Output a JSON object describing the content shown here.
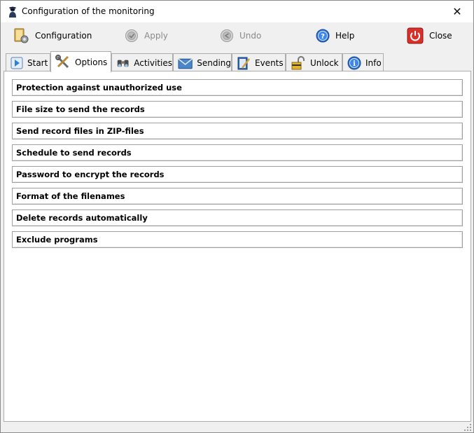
{
  "window": {
    "title": "Configuration of the monitoring",
    "close_glyph": "✕"
  },
  "toolbar": {
    "configuration": "Configuration",
    "apply": "Apply",
    "undo": "Undo",
    "help": "Help",
    "close": "Close"
  },
  "tabs": [
    {
      "label": "Start",
      "icon": "play-icon"
    },
    {
      "label": "Options",
      "icon": "tools-icon",
      "active": true
    },
    {
      "label": "Activities",
      "icon": "binoculars-icon"
    },
    {
      "label": "Sending",
      "icon": "mail-icon"
    },
    {
      "label": "Events",
      "icon": "notepad-icon"
    },
    {
      "label": "Unlock",
      "icon": "padlock-icon"
    },
    {
      "label": "Info",
      "icon": "info-icon"
    }
  ],
  "sections": [
    "Protection against unauthorized use",
    "File size to send the records",
    "Send record files in ZIP-files",
    "Schedule to send records",
    "Password to encrypt the records",
    "Format of the filenames",
    "Delete records automatically",
    "Exclude programs"
  ],
  "colors": {
    "help_blue": "#2a6fd6",
    "close_red": "#d8312a",
    "apply_gray": "#9a9a9a"
  }
}
